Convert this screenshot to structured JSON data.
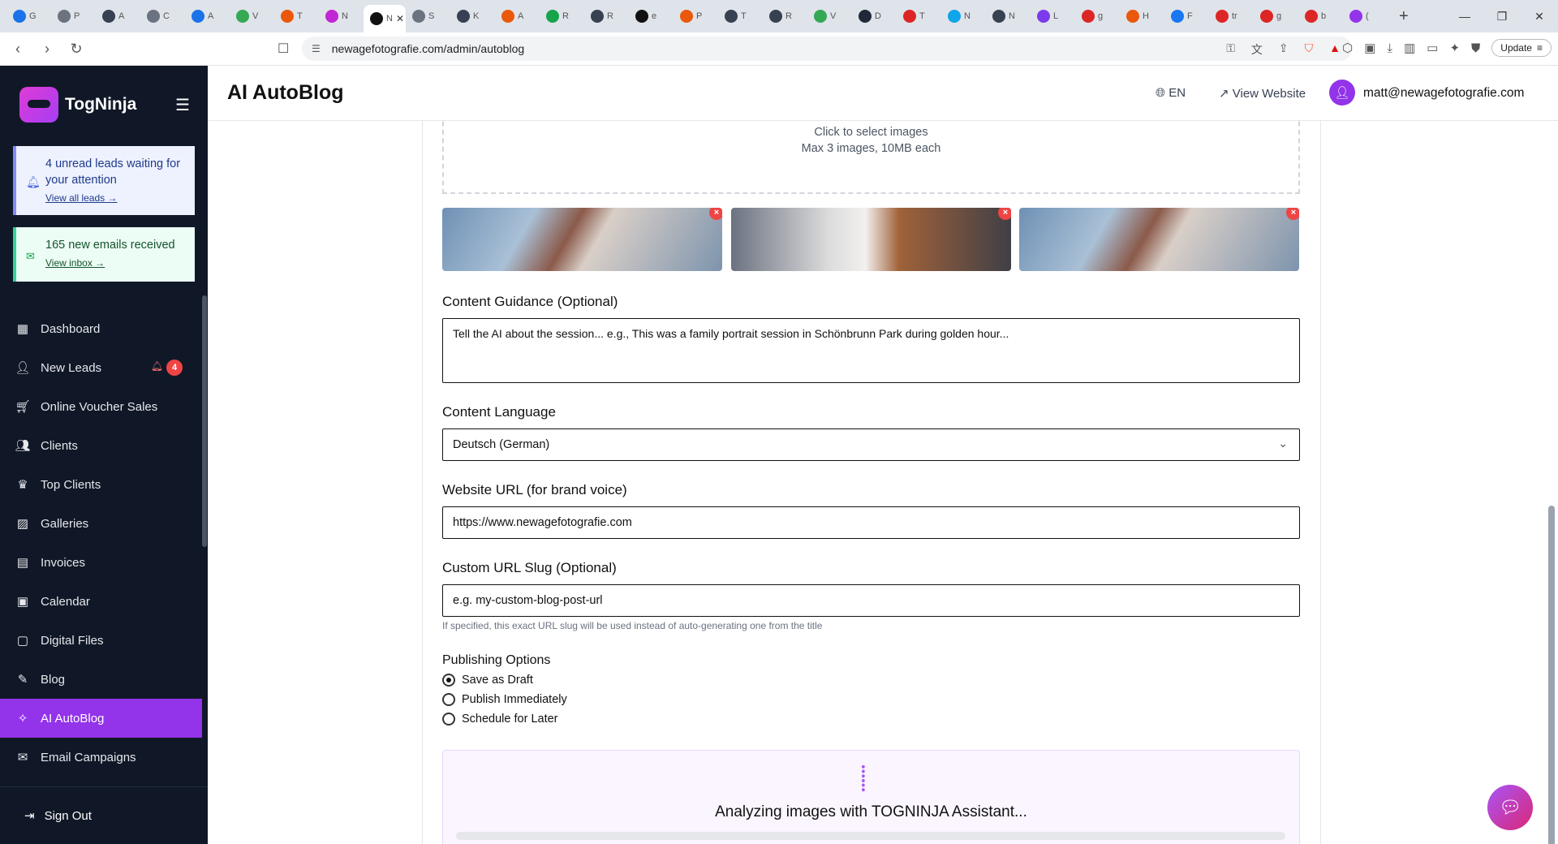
{
  "browser": {
    "tabs": [
      {
        "letter": "G",
        "color": "#1a73e8"
      },
      {
        "letter": "P",
        "color": "#6b7280"
      },
      {
        "letter": "A",
        "color": "#374151"
      },
      {
        "letter": "C",
        "color": "#6b7280"
      },
      {
        "letter": "A",
        "color": "#1a73e8"
      },
      {
        "letter": "V",
        "color": "#34a853"
      },
      {
        "letter": "T",
        "color": "#ea580c"
      },
      {
        "letter": "N",
        "color": "#c026d3"
      },
      {
        "letter": "N",
        "color": "#111"
      },
      {
        "letter": "S",
        "color": "#6b7280"
      },
      {
        "letter": "K",
        "color": "#374151"
      },
      {
        "letter": "A",
        "color": "#ea580c"
      },
      {
        "letter": "R",
        "color": "#16a34a"
      },
      {
        "letter": "R",
        "color": "#374151"
      },
      {
        "letter": "e",
        "color": "#111"
      },
      {
        "letter": "P",
        "color": "#ea580c"
      },
      {
        "letter": "T",
        "color": "#374151"
      },
      {
        "letter": "R",
        "color": "#374151"
      },
      {
        "letter": "V",
        "color": "#34a853"
      },
      {
        "letter": "D",
        "color": "#1f2937"
      },
      {
        "letter": "T",
        "color": "#dc2626"
      },
      {
        "letter": "N",
        "color": "#0ea5e9"
      },
      {
        "letter": "N",
        "color": "#374151"
      },
      {
        "letter": "L",
        "color": "#7c3aed"
      },
      {
        "letter": "g",
        "color": "#dc2626"
      },
      {
        "letter": "H",
        "color": "#ea580c"
      },
      {
        "letter": "F",
        "color": "#1877f2"
      },
      {
        "letter": "tr",
        "color": "#dc2626"
      },
      {
        "letter": "g",
        "color": "#dc2626"
      },
      {
        "letter": "b",
        "color": "#dc2626"
      },
      {
        "letter": "(",
        "color": "#9333ea"
      }
    ],
    "url": "newagefotografie.com/admin/autoblog",
    "update_label": "Update"
  },
  "sidebar": {
    "brand": "TogNinja",
    "alerts": {
      "leads_text": "4 unread leads waiting for your attention",
      "leads_link": "View all leads →",
      "mail_text": "165 new emails received",
      "mail_link": "View inbox →"
    },
    "items": [
      {
        "label": "Dashboard",
        "icon": "grid-icon"
      },
      {
        "label": "New Leads",
        "icon": "user-plus-icon",
        "badge": "4"
      },
      {
        "label": "Online Voucher Sales",
        "icon": "cart-icon"
      },
      {
        "label": "Clients",
        "icon": "users-icon"
      },
      {
        "label": "Top Clients",
        "icon": "crown-icon"
      },
      {
        "label": "Galleries",
        "icon": "image-icon"
      },
      {
        "label": "Invoices",
        "icon": "file-icon"
      },
      {
        "label": "Calendar",
        "icon": "calendar-icon"
      },
      {
        "label": "Digital Files",
        "icon": "folder-icon"
      },
      {
        "label": "Blog",
        "icon": "pen-icon"
      },
      {
        "label": "AI AutoBlog",
        "icon": "wand-icon",
        "active": true
      },
      {
        "label": "Email Campaigns",
        "icon": "mail-icon"
      }
    ],
    "sign_out": "Sign Out"
  },
  "header": {
    "title": "AI AutoBlog",
    "lang": "EN",
    "view_website": "View Website",
    "email": "matt@newagefotografie.com"
  },
  "form": {
    "dropzone": {
      "line1": "Click to select images",
      "line2": "Max 3 images, 10MB each"
    },
    "guidance_label": "Content Guidance (Optional)",
    "guidance_placeholder": "Tell the AI about the session... e.g., This was a family portrait session in Schönbrunn Park during golden hour...",
    "language_label": "Content Language",
    "language_value": "Deutsch (German)",
    "website_label": "Website URL (for brand voice)",
    "website_value": "https://www.newagefotografie.com",
    "slug_label": "Custom URL Slug (Optional)",
    "slug_placeholder": "e.g. my-custom-blog-post-url",
    "slug_hint": "If specified, this exact URL slug will be used instead of auto-generating one from the title",
    "publishing_label": "Publishing Options",
    "publishing_options": [
      "Save as Draft",
      "Publish Immediately",
      "Schedule for Later"
    ],
    "publishing_selected": "Save as Draft",
    "analyzing_text": "Analyzing images with TOGNINJA Assistant..."
  },
  "colors": {
    "sidebar_bg": "#101827",
    "accent": "#9333ea",
    "danger": "#ef4444"
  }
}
